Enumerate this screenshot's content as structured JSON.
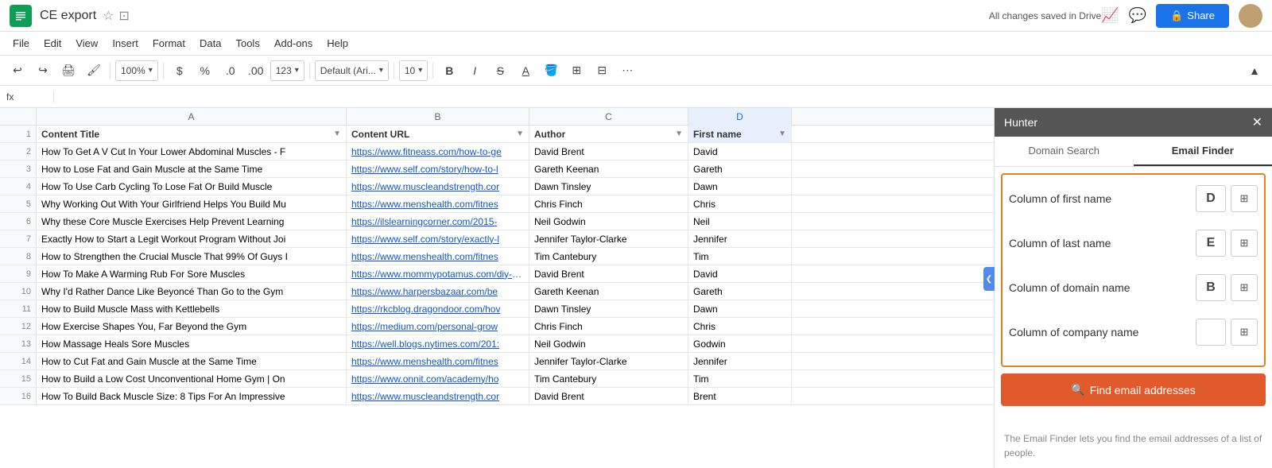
{
  "titleBar": {
    "appName": "CE export",
    "starIcon": "★",
    "folderIcon": "🗁",
    "autosave": "All changes saved in Drive",
    "shareLabel": "Share",
    "lockIcon": "🔒"
  },
  "menuBar": {
    "items": [
      "File",
      "Edit",
      "View",
      "Insert",
      "Format",
      "Data",
      "Tools",
      "Add-ons",
      "Help"
    ]
  },
  "toolbar": {
    "zoom": "100%",
    "currency": "$",
    "percent": "%",
    "decimal1": ".0",
    "decimal2": ".00",
    "format123": "123",
    "font": "Default (Ari...",
    "fontSize": "10",
    "bold": "B",
    "italic": "I",
    "strikethrough": "S"
  },
  "columnHeaders": [
    "A",
    "B",
    "C",
    "D"
  ],
  "rows": [
    {
      "num": "1",
      "a": "Content Title",
      "b": "Content URL",
      "c": "Author",
      "d": "First name",
      "isHeader": true
    },
    {
      "num": "2",
      "a": "How To Get A V Cut In Your Lower Abdominal Muscles - F",
      "b": "https://www.fitneass.com/how-to-ge",
      "c": "David Brent",
      "d": "David"
    },
    {
      "num": "3",
      "a": "How to Lose Fat and Gain Muscle at the Same Time",
      "b": "https://www.self.com/story/how-to-l",
      "c": "Gareth Keenan",
      "d": "Gareth"
    },
    {
      "num": "4",
      "a": "How To Use Carb Cycling To Lose Fat Or Build Muscle",
      "b": "https://www.muscleandstrength.cor",
      "c": "Dawn Tinsley",
      "d": "Dawn"
    },
    {
      "num": "5",
      "a": "Why Working Out With Your Girlfriend Helps You Build Mu",
      "b": "https://www.menshealth.com/fitnes",
      "c": "Chris Finch",
      "d": "Chris"
    },
    {
      "num": "6",
      "a": "Why these Core Muscle Exercises Help Prevent Learning",
      "b": "https://ilslearningcorner.com/2015-",
      "c": "Neil Godwin",
      "d": "Neil"
    },
    {
      "num": "7",
      "a": "Exactly How to Start a Legit Workout Program Without Joi",
      "b": "https://www.self.com/story/exactly-l",
      "c": "Jennifer Taylor-Clarke",
      "d": "Jennifer"
    },
    {
      "num": "8",
      "a": "How to Strengthen the Crucial Muscle That 99% Of Guys I",
      "b": "https://www.menshealth.com/fitnes",
      "c": "Tim Cantebury",
      "d": "Tim"
    },
    {
      "num": "9",
      "a": "How To Make A Warming Rub For Sore Muscles",
      "b": "https://www.mommypotamus.com/diy-wa",
      "c": "David Brent",
      "d": "David"
    },
    {
      "num": "10",
      "a": "Why I'd Rather Dance Like Beyoncé Than Go to the Gym",
      "b": "https://www.harpersbazaar.com/be",
      "c": "Gareth Keenan",
      "d": "Gareth"
    },
    {
      "num": "11",
      "a": "How to Build Muscle Mass with Kettlebells",
      "b": "https://rkcblog.dragondoor.com/hov",
      "c": "Dawn Tinsley",
      "d": "Dawn"
    },
    {
      "num": "12",
      "a": "How Exercise Shapes You, Far Beyond the Gym",
      "b": "https://medium.com/personal-grow",
      "c": "Chris Finch",
      "d": "Chris"
    },
    {
      "num": "13",
      "a": "How Massage Heals Sore Muscles",
      "b": "https://well.blogs.nytimes.com/201:",
      "c": "Neil Godwin",
      "d": "Godwin"
    },
    {
      "num": "14",
      "a": "How to Cut Fat and Gain Muscle at the Same Time",
      "b": "https://www.menshealth.com/fitnes",
      "c": "Jennifer Taylor-Clarke",
      "d": "Jennifer"
    },
    {
      "num": "15",
      "a": "How to Build a Low Cost Unconventional Home Gym | On",
      "b": "https://www.onnit.com/academy/ho",
      "c": "Tim Cantebury",
      "d": "Tim"
    },
    {
      "num": "16",
      "a": "How To Build Back Muscle Size: 8 Tips For An Impressive",
      "b": "https://www.muscleandstrength.cor",
      "c": "David Brent",
      "d": "Brent"
    }
  ],
  "hunter": {
    "title": "Hunter",
    "closeIcon": "✕",
    "tabs": [
      {
        "label": "Domain Search",
        "active": false
      },
      {
        "label": "Email Finder",
        "active": true
      }
    ],
    "emailFinder": {
      "fields": [
        {
          "label": "Column of first name",
          "badge": "D",
          "hasGrid": true,
          "isEmpty": false
        },
        {
          "label": "Column of last name",
          "badge": "E",
          "hasGrid": true,
          "isEmpty": false
        },
        {
          "label": "Column of domain name",
          "badge": "B",
          "hasGrid": true,
          "isEmpty": false
        },
        {
          "label": "Column of company name",
          "badge": "",
          "hasGrid": true,
          "isEmpty": true
        }
      ],
      "findButton": "Find email addresses",
      "searchIcon": "🔍",
      "footerText": "The Email Finder lets you find the email addresses of a list of people."
    }
  }
}
